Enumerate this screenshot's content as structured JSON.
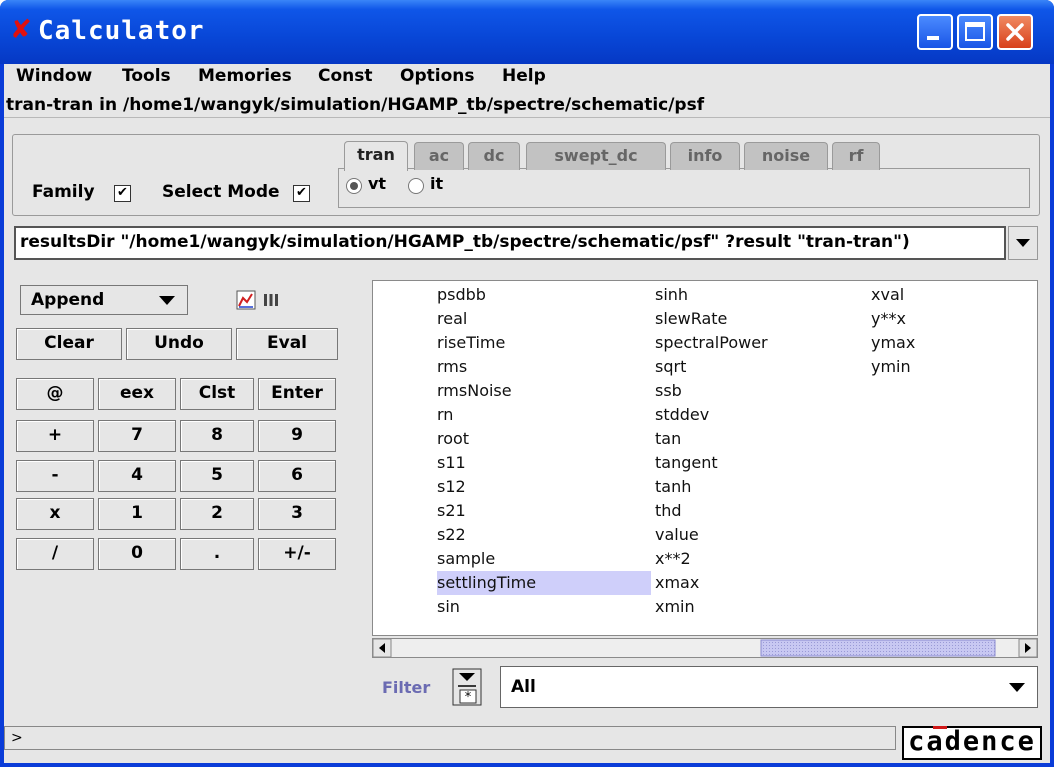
{
  "window": {
    "title": "Calculator",
    "close_glyph": "✘"
  },
  "menubar": {
    "items": [
      "Window",
      "Tools",
      "Memories",
      "Const",
      "Options",
      "Help"
    ]
  },
  "context_path": "tran-tran in /home1/wangyk/simulation/HGAMP_tb/spectre/schematic/psf",
  "options": {
    "family_label": "Family",
    "family_checked": true,
    "select_mode_label": "Select Mode",
    "select_mode_checked": true
  },
  "analysis_tabs": {
    "tabs": [
      "tran",
      "ac",
      "dc",
      "swept_dc",
      "info",
      "noise",
      "rf"
    ],
    "active": "tran",
    "radios": [
      {
        "label": "vt",
        "selected": true
      },
      {
        "label": "it",
        "selected": false
      }
    ]
  },
  "command_line": {
    "value": "resultsDir \"/home1/wangyk/simulation/HGAMP_tb/spectre/schematic/psf\" ?result \"tran-tran\")"
  },
  "stack_mode": {
    "value": "Append"
  },
  "action_buttons": [
    "Clear",
    "Undo",
    "Eval"
  ],
  "keypad": [
    [
      "@",
      "eex",
      "Clst",
      "Enter"
    ],
    [
      "+",
      "7",
      "8",
      "9"
    ],
    [
      "-",
      "4",
      "5",
      "6"
    ],
    [
      "x",
      "1",
      "2",
      "3"
    ],
    [
      "/",
      "0",
      ".",
      "+/-"
    ]
  ],
  "function_list": {
    "columns": [
      [
        "psdbb",
        "real",
        "riseTime",
        "rms",
        "rmsNoise",
        "rn",
        "root",
        "s11",
        "s12",
        "s21",
        "s22",
        "sample",
        "settlingTime",
        "sin"
      ],
      [
        "sinh",
        "slewRate",
        "spectralPower",
        "sqrt",
        "ssb",
        "stddev",
        "tan",
        "tangent",
        "tanh",
        "thd",
        "value",
        "x**2",
        "xmax",
        "xmin"
      ],
      [
        "xval",
        "y**x",
        "ymax",
        "ymin"
      ]
    ],
    "selected": "settlingTime",
    "selection_color": "#cfcffa"
  },
  "filter": {
    "label": "Filter",
    "value": "All"
  },
  "status": {
    "prompt": ">"
  },
  "brand": {
    "text": "cadence",
    "accent": "#d01818"
  }
}
